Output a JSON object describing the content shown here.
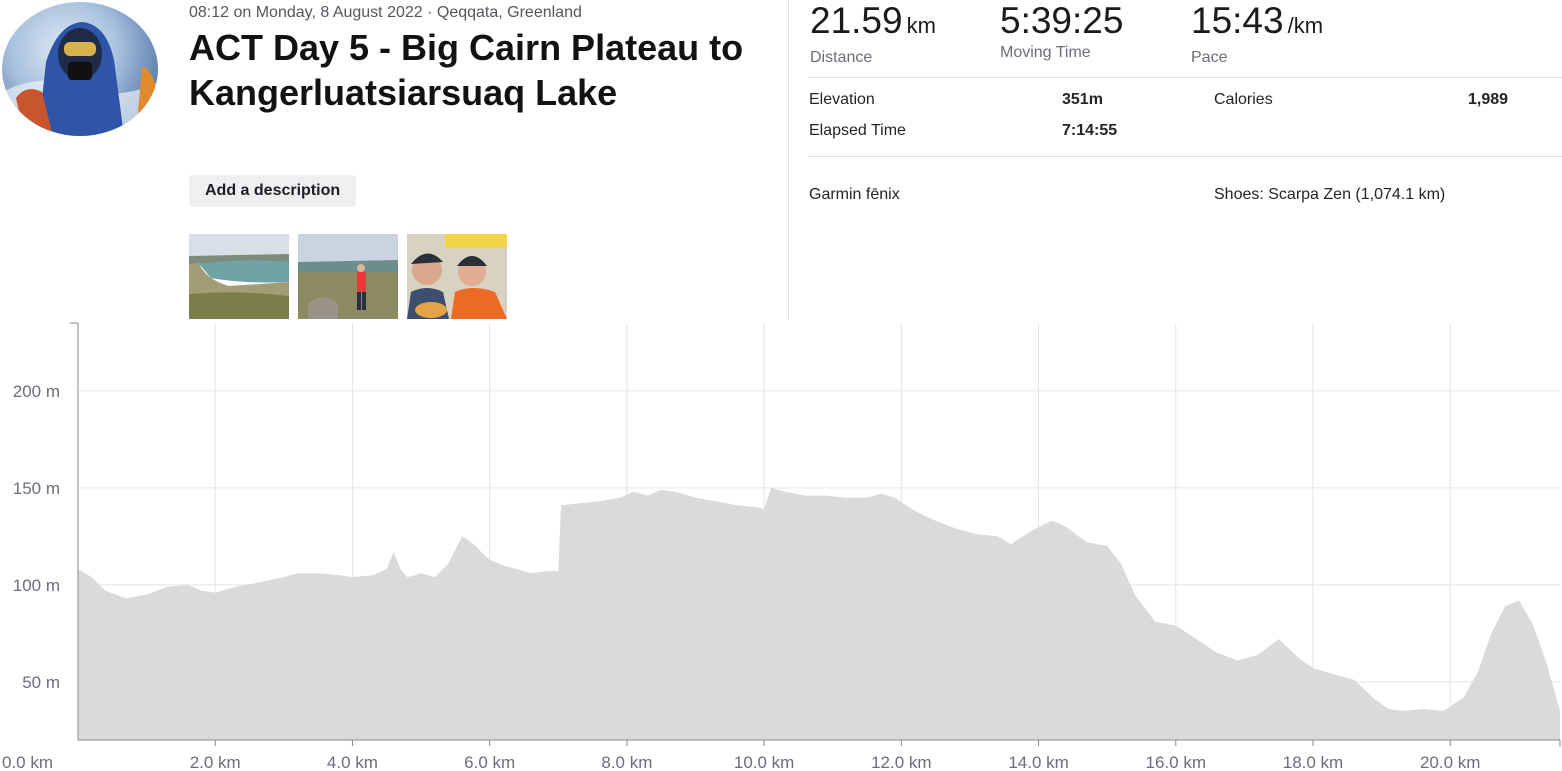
{
  "activity": {
    "meta": "08:12 on Monday, 8 August 2022 · Qeqqata, Greenland",
    "title": "ACT Day 5 - Big Cairn Plateau to Kangerluatsiarsuaq Lake",
    "add_description_label": "Add a description"
  },
  "stats": {
    "distance": {
      "value": "21.59",
      "unit": "km",
      "label": "Distance"
    },
    "moving_time": {
      "value": "5:39:25",
      "unit": "",
      "label": "Moving Time"
    },
    "pace": {
      "value": "15:43",
      "unit": "/km",
      "label": "Pace"
    },
    "elevation": {
      "label": "Elevation",
      "value": "351m"
    },
    "calories": {
      "label": "Calories",
      "value": "1,989"
    },
    "elapsed_time": {
      "label": "Elapsed Time",
      "value": "7:14:55"
    },
    "device": "Garmin fēnix",
    "shoes": "Shoes: Scarpa Zen (1,074.1 km)"
  },
  "chart_data": {
    "type": "area",
    "title": "",
    "xlabel": "",
    "ylabel": "",
    "xlim": [
      0,
      21.6
    ],
    "ylim": [
      20,
      235
    ],
    "grid": true,
    "x_ticks": [
      0,
      2,
      4,
      6,
      8,
      10,
      12,
      14,
      16,
      18,
      20
    ],
    "x_tick_labels": [
      "0.0 km",
      "2.0 km",
      "4.0 km",
      "6.0 km",
      "8.0 km",
      "10.0 km",
      "12.0 km",
      "14.0 km",
      "16.0 km",
      "18.0 km",
      "20.0 km"
    ],
    "y_ticks": [
      50,
      100,
      150,
      200
    ],
    "y_tick_labels": [
      "50 m",
      "100 m",
      "150 m",
      "200 m"
    ],
    "fill_color": "#dadada",
    "grid_color": "#e4e4e4",
    "series": [
      {
        "x": [
          0,
          0.2,
          0.4,
          0.7,
          1.0,
          1.3,
          1.6,
          1.8,
          2.0,
          2.3,
          2.6,
          3.0,
          3.2,
          3.5,
          3.8,
          4.0,
          4.3,
          4.5,
          4.6,
          4.7,
          4.8,
          5.0,
          5.2,
          5.4,
          5.6,
          5.8,
          5.9,
          6.0,
          6.2,
          6.4,
          6.6,
          6.8,
          7.0,
          7.04,
          7.3,
          7.6,
          7.9,
          8.1,
          8.3,
          8.5,
          8.7,
          9.0,
          9.3,
          9.6,
          9.9,
          10.0,
          10.1,
          10.3,
          10.6,
          10.9,
          11.2,
          11.5,
          11.7,
          11.9,
          12.2,
          12.5,
          12.8,
          13.1,
          13.4,
          13.6,
          13.9,
          14.2,
          14.4,
          14.7,
          15.0,
          15.2,
          15.4,
          15.7,
          16.0,
          16.3,
          16.6,
          16.9,
          17.2,
          17.5,
          17.8,
          18.0,
          18.3,
          18.6,
          18.9,
          19.1,
          19.3,
          19.6,
          19.9,
          20.2,
          20.4,
          20.6,
          20.8,
          21.0,
          21.2,
          21.4,
          21.6
        ],
        "y": [
          108,
          104,
          97,
          93,
          95,
          99,
          100,
          97,
          96,
          99,
          101,
          104,
          106,
          106,
          105,
          104,
          105,
          108,
          117,
          108,
          104,
          106,
          104,
          111,
          125,
          120,
          116,
          113,
          110,
          108,
          106,
          107,
          107,
          141,
          142,
          143,
          145,
          148,
          146,
          149,
          148,
          145,
          143,
          141,
          140,
          139,
          150,
          148,
          146,
          146,
          145,
          145,
          147,
          145,
          138,
          133,
          129,
          126,
          125,
          121,
          128,
          133,
          130,
          122,
          120,
          111,
          95,
          81,
          79,
          72,
          65,
          61,
          64,
          72,
          62,
          57,
          54,
          51,
          41,
          36,
          35,
          36,
          35,
          42,
          55,
          75,
          89,
          92,
          80,
          60,
          35
        ]
      }
    ]
  }
}
